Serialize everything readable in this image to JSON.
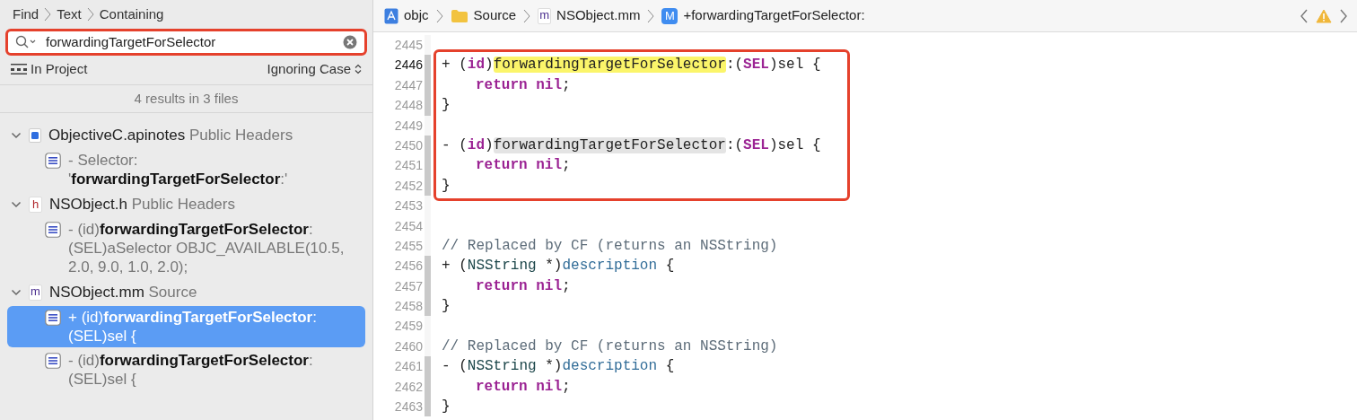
{
  "find_panel": {
    "path": [
      "Find",
      "Text",
      "Containing"
    ],
    "search": {
      "value": "forwardingTargetForSelector",
      "boxed": true
    },
    "scope": "In Project",
    "case_mode": "Ignoring Case",
    "summary": "4 results in 3 files",
    "files": [
      {
        "kind": "apinotes",
        "name": "ObjectiveC.apinotes",
        "group": "Public Headers",
        "expanded": true,
        "matches": [
          {
            "text": "- Selector: '**forwardingTargetForSelector**:'",
            "selected": false
          }
        ]
      },
      {
        "kind": "header",
        "icon_letter": "h",
        "name": "NSObject.h",
        "group": "Public Headers",
        "expanded": true,
        "matches": [
          {
            "text": "- (id)**forwardingTargetForSelector**:(SEL)aSelector OBJC_AVAILABLE(10.5, 2.0, 9.0, 1.0, 2.0);",
            "selected": false
          }
        ]
      },
      {
        "kind": "source",
        "icon_letter": "m",
        "name": "NSObject.mm",
        "group": "Source",
        "expanded": true,
        "matches": [
          {
            "text": "+ (id)**forwardingTargetForSelector**:(SEL)sel {",
            "selected": true
          },
          {
            "text": "- (id)**forwardingTargetForSelector**:(SEL)sel {",
            "selected": false
          }
        ]
      }
    ]
  },
  "editor": {
    "breadcrumb": [
      {
        "kind": "project",
        "label": "objc"
      },
      {
        "kind": "folder",
        "label": "Source"
      },
      {
        "kind": "file",
        "icon_letter": "m",
        "label": "NSObject.mm"
      },
      {
        "kind": "method",
        "icon_letter": "M",
        "label": "+forwardingTargetForSelector:"
      }
    ],
    "blocks": [
      {
        "lines": [
          {
            "number": "2445",
            "fold": false,
            "current": false
          }
        ]
      },
      {
        "boxed": true,
        "lines": [
          {
            "number": "2446",
            "fold": true,
            "current": true,
            "tokens": [
              {
                "kind": "plain",
                "text": "+ ("
              },
              {
                "kind": "keyword",
                "text": "id"
              },
              {
                "kind": "plain",
                "text": ")"
              },
              {
                "kind": "match_current",
                "text": "forwardingTargetForSelector"
              },
              {
                "kind": "plain",
                "text": ":("
              },
              {
                "kind": "keyword",
                "text": "SEL"
              },
              {
                "kind": "plain",
                "text": ")sel {"
              }
            ],
            "children": [
              {
                "number": "2447",
                "fold": true,
                "current": false,
                "tokens": [
                  {
                    "kind": "keyword",
                    "text": "return nil"
                  },
                  {
                    "kind": "plain",
                    "text": ";"
                  }
                ]
              }
            ]
          },
          {
            "number": "2448",
            "fold": true,
            "current": false,
            "tokens": [
              {
                "kind": "plain",
                "text": "}"
              }
            ]
          },
          {
            "number": "2449",
            "fold": false,
            "current": false
          },
          {
            "number": "2450",
            "fold": true,
            "current": false,
            "tokens": [
              {
                "kind": "plain",
                "text": "- ("
              },
              {
                "kind": "keyword",
                "text": "id"
              },
              {
                "kind": "plain",
                "text": ")"
              },
              {
                "kind": "match",
                "text": "forwardingTargetForSelector"
              },
              {
                "kind": "plain",
                "text": ":("
              },
              {
                "kind": "keyword",
                "text": "SEL"
              },
              {
                "kind": "plain",
                "text": ")sel {"
              }
            ],
            "children": [
              {
                "number": "2451",
                "fold": true,
                "current": false,
                "tokens": [
                  {
                    "kind": "keyword",
                    "text": "return nil"
                  },
                  {
                    "kind": "plain",
                    "text": ";"
                  }
                ]
              }
            ]
          },
          {
            "number": "2452",
            "fold": true,
            "current": false,
            "tokens": [
              {
                "kind": "plain",
                "text": "}"
              }
            ]
          }
        ]
      },
      {
        "lines": [
          {
            "number": "2453",
            "fold": false,
            "current": false
          },
          {
            "number": "2454",
            "fold": false,
            "current": false
          },
          {
            "number": "2455",
            "fold": false,
            "current": false,
            "tokens": [
              {
                "kind": "comment",
                "text": "// Replaced by CF (returns an NSString)"
              }
            ]
          },
          {
            "number": "2456",
            "fold": true,
            "current": false,
            "tokens": [
              {
                "kind": "plain",
                "text": "+ ("
              },
              {
                "kind": "class",
                "text": "NSString"
              },
              {
                "kind": "plain",
                "text": " *)"
              },
              {
                "kind": "method",
                "text": "description"
              },
              {
                "kind": "plain",
                "text": " {"
              }
            ],
            "children": [
              {
                "number": "2457",
                "fold": true,
                "current": false,
                "tokens": [
                  {
                    "kind": "keyword",
                    "text": "return nil"
                  },
                  {
                    "kind": "plain",
                    "text": ";"
                  }
                ]
              }
            ]
          },
          {
            "number": "2458",
            "fold": true,
            "current": false,
            "tokens": [
              {
                "kind": "plain",
                "text": "}"
              }
            ]
          },
          {
            "number": "2459",
            "fold": false,
            "current": false
          },
          {
            "number": "2460",
            "fold": false,
            "current": false,
            "tokens": [
              {
                "kind": "comment",
                "text": "// Replaced by CF (returns an NSString)"
              }
            ]
          },
          {
            "number": "2461",
            "fold": true,
            "current": false,
            "tokens": [
              {
                "kind": "plain",
                "text": "- ("
              },
              {
                "kind": "class",
                "text": "NSString"
              },
              {
                "kind": "plain",
                "text": " *)"
              },
              {
                "kind": "method",
                "text": "description"
              },
              {
                "kind": "plain",
                "text": " {"
              }
            ],
            "children": [
              {
                "number": "2462",
                "fold": true,
                "current": false,
                "tokens": [
                  {
                    "kind": "keyword",
                    "text": "return nil"
                  },
                  {
                    "kind": "plain",
                    "text": ";"
                  }
                ]
              }
            ]
          },
          {
            "number": "2463",
            "fold": true,
            "current": false,
            "tokens": [
              {
                "kind": "plain",
                "text": "}"
              }
            ]
          }
        ]
      }
    ]
  }
}
